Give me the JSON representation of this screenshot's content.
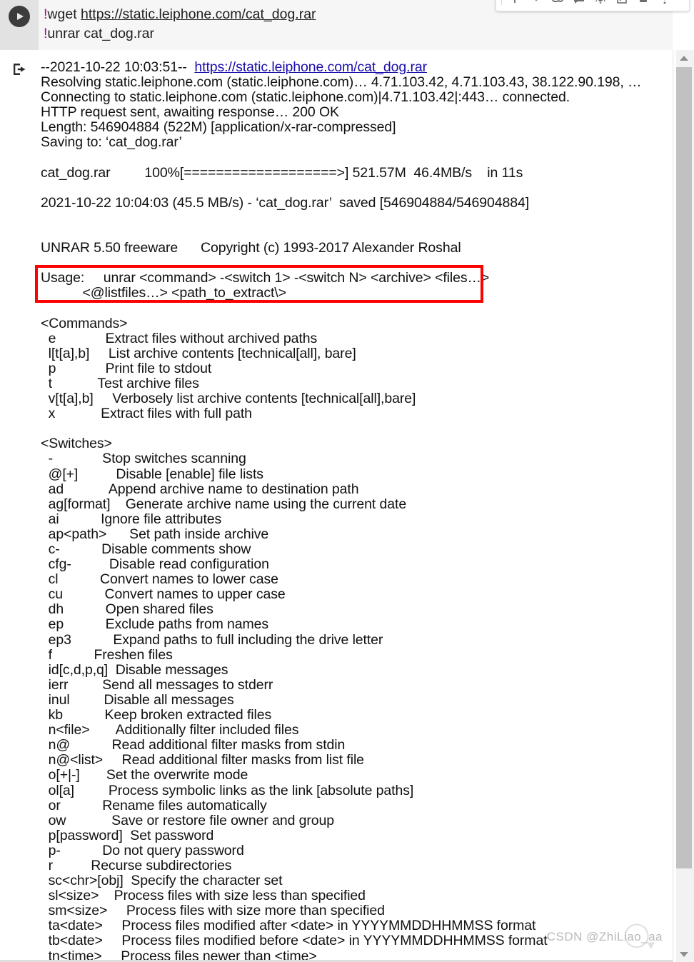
{
  "toolbar": {
    "items": [
      {
        "name": "move-up-icon",
        "glyph": "up"
      },
      {
        "name": "move-down-icon",
        "glyph": "down"
      },
      {
        "name": "link-icon",
        "glyph": "link"
      },
      {
        "name": "comment-icon",
        "glyph": "comment"
      },
      {
        "name": "settings-icon",
        "glyph": "gear"
      },
      {
        "name": "open-in-new-tab-icon",
        "glyph": "popout"
      },
      {
        "name": "delete-cell-icon",
        "glyph": "trash"
      },
      {
        "name": "more-options-icon",
        "glyph": "kebab"
      }
    ]
  },
  "code_cell": {
    "run_button_label": "Run cell",
    "lines": [
      {
        "bang": "!",
        "cmd": "wget ",
        "link": "https://static.leiphone.com/cat_dog.rar"
      },
      {
        "bang": "!",
        "cmd": "unrar cat_dog.rar",
        "link": ""
      }
    ]
  },
  "output": {
    "gutter_icon": "output-stream-icon",
    "lines": [
      "--2021-10-22 10:03:51--  ",
      "Resolving static.leiphone.com (static.leiphone.com)… 4.71.103.42, 4.71.103.43, 38.122.90.198, …",
      "Connecting to static.leiphone.com (static.leiphone.com)|4.71.103.42|:443… connected.",
      "HTTP request sent, awaiting response… 200 OK",
      "Length: 546904884 (522M) [application/x-rar-compressed]",
      "Saving to: ‘cat_dog.rar’",
      "",
      "cat_dog.rar         100%[===================>] 521.57M  46.4MB/s    in 11s",
      "",
      "2021-10-22 10:04:03 (45.5 MB/s) - ‘cat_dog.rar’  saved [546904884/546904884]",
      "",
      "",
      "UNRAR 5.50 freeware      Copyright (c) 1993-2017 Alexander Roshal",
      "",
      "Usage:     unrar <command> -<switch 1> -<switch N> <archive> <files…>",
      "           <@listfiles…> <path_to_extract\\>",
      "",
      "<Commands>",
      "  e             Extract files without archived paths",
      "  l[t[a],b]     List archive contents [technical[all], bare]",
      "  p             Print file to stdout",
      "  t            Test archive files",
      "  v[t[a],b]     Verbosely list archive contents [technical[all],bare]",
      "  x            Extract files with full path",
      "",
      "<Switches>",
      "  -             Stop switches scanning",
      "  @[+]          Disable [enable] file lists",
      "  ad            Append archive name to destination path",
      "  ag[format]    Generate archive name using the current date",
      "  ai           Ignore file attributes",
      "  ap<path>      Set path inside archive",
      "  c-           Disable comments show",
      "  cfg-          Disable read configuration",
      "  cl           Convert names to lower case",
      "  cu           Convert names to upper case",
      "  dh           Open shared files",
      "  ep           Exclude paths from names",
      "  ep3           Expand paths to full including the drive letter",
      "  f           Freshen files",
      "  id[c,d,p,q]  Disable messages",
      "  ierr         Send all messages to stderr",
      "  inul         Disable all messages",
      "  kb           Keep broken extracted files",
      "  n<file>       Additionally filter included files",
      "  n@           Read additional filter masks from stdin",
      "  n@<list>     Read additional filter masks from list file",
      "  o[+|-]       Set the overwrite mode",
      "  ol[a]         Process symbolic links as the link [absolute paths]",
      "  or           Rename files automatically",
      "  ow            Save or restore file owner and group",
      "  p[password]  Set password",
      "  p-           Do not query password",
      "  r          Recurse subdirectories",
      "  sc<chr>[obj]  Specify the character set",
      "  sl<size>    Process files with size less than specified",
      "  sm<size>     Process files with size more than specified",
      "  ta<date>     Process files modified after <date> in YYYYMMDDHHMMSS format",
      "  tb<date>     Process files modified before <date> in YYYYMMDDHHMMSS format",
      "  tn<time>     Process files newer than <time>"
    ],
    "first_line_link": "https://static.leiphone.com/cat_dog.rar"
  },
  "highlight": {
    "color": "#ff0000",
    "target": "usage-block"
  },
  "scrollbar": {
    "up_arrow": "scroll-up-arrow-icon",
    "down_arrow": "scroll-down-arrow-icon"
  },
  "watermark": {
    "text": "CSDN @ZhiLiao_aa"
  }
}
